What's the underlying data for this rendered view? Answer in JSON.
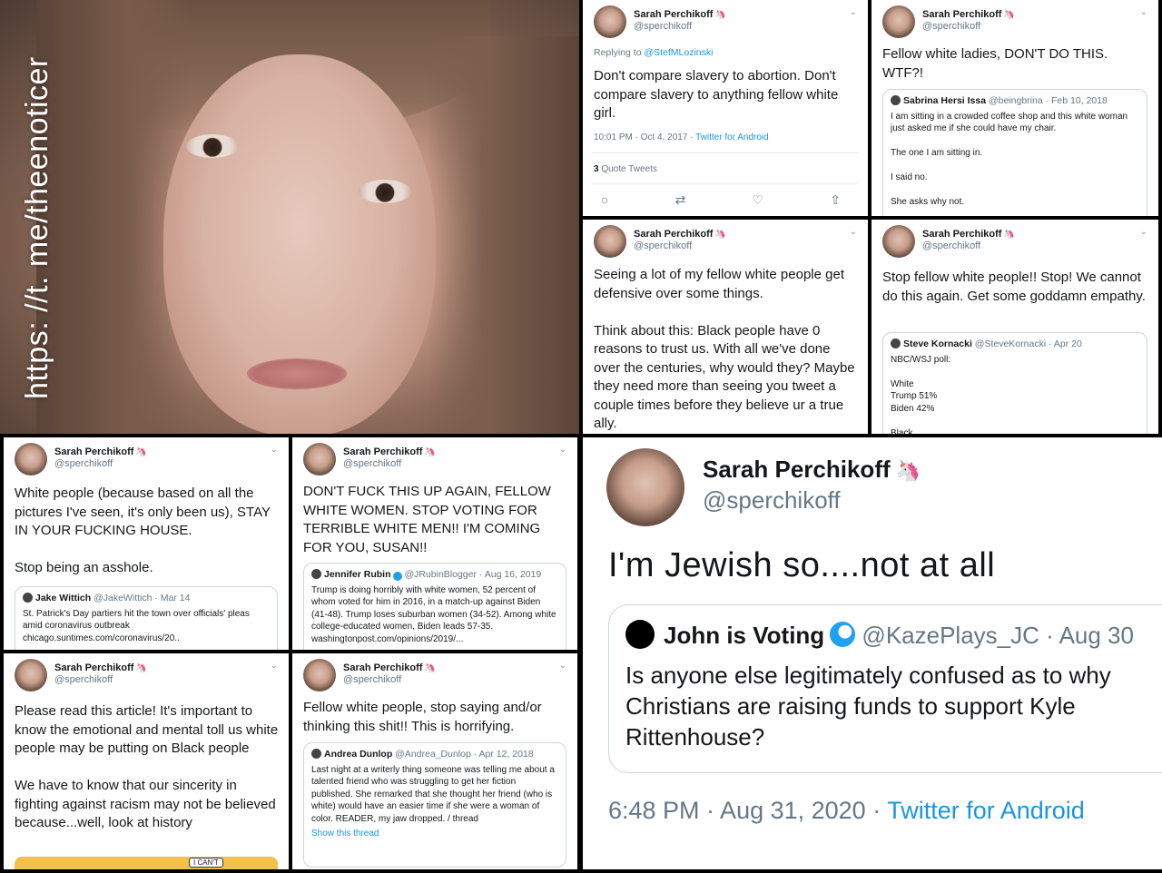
{
  "watermark": "https: //t. me/theenoticer",
  "author": {
    "name": "Sarah Perchikoff",
    "handle": "@sperchikoff",
    "emoji": "🦄"
  },
  "t1": {
    "reply": "Replying to",
    "reply_to": "@StefMLozinski",
    "text": "Don't compare slavery to abortion. Don't compare slavery to anything fellow white girl.",
    "time": "10:01 PM · Oct 4, 2017 ·",
    "source": "Twitter for Android",
    "quote_count": "3",
    "quote_label": "Quote Tweets"
  },
  "t2": {
    "text": "Fellow white ladies, DON'T DO THIS. WTF?!",
    "q_name": "Sabrina Hersi Issa",
    "q_meta": "@beingbrina · Feb 10, 2018",
    "q_text": "I am sitting in a crowded coffee shop and this white woman just asked me if she could have my chair.\n\nThe one I am sitting in.\n\nI said no.\n\nShe asks why not."
  },
  "t3": {
    "text": "Seeing a lot of my fellow white people get defensive over some things.\n\nThink about this: Black people have 0 reasons to trust us. With all we've done over the centuries, why would they? Maybe they need more than seeing you tweet a couple times before they believe ur a true ally."
  },
  "t4": {
    "text": "Stop fellow white people!! Stop! We cannot do this again. Get some goddamn empathy.",
    "q_name": "Steve Kornacki",
    "q_meta": "@SteveKornacki · Apr 20",
    "q_text": "NBC/WSJ poll:\n\nWhite\nTrump 51%\nBiden 42%\n\nBlack"
  },
  "t5": {
    "text": "White people (because based on all the pictures I've seen, it's only been us), STAY IN YOUR FUCKING HOUSE.\n\nStop being an asshole.",
    "q_name": "Jake Wittich",
    "q_meta": "@JakeWittich · Mar 14",
    "q_text": "St. Patrick's Day partiers hit the town over officials' pleas amid coronavirus outbreak\nchicago.suntimes.com/coronavirus/20.."
  },
  "t6": {
    "text": "DON'T FUCK THIS UP AGAIN, FELLOW WHITE WOMEN. STOP VOTING FOR TERRIBLE WHITE MEN!! I'M COMING FOR YOU, SUSAN!!",
    "q_name": "Jennifer Rubin",
    "q_meta": "@JRubinBlogger · Aug 16, 2019",
    "q_text": "Trump is doing horribly with white women, 52 percent of whom voted for him in 2016, in a match-up against Biden (41-48). Trump loses suburban women (34-52). Among white college-educated women, Biden leads 57-35.  washingtonpost.com/opinions/2019/..."
  },
  "t7": {
    "text": "Please read this article! It's important to know the emotional and mental toll us white people may be putting on Black people\n\nWe have to know that our sincerity in fighting against racism may not be believed because...well, look at history",
    "img_text": "I CAN'T"
  },
  "t8": {
    "text": "Fellow white people, stop saying and/or thinking this shit!! This is horrifying.",
    "q_name": "Andrea Dunlop",
    "q_meta": "@Andrea_Dunlop · Apr 12, 2018",
    "q_text": "Last night at a writerly thing someone was telling me about a talented friend who was struggling to get her fiction published. She remarked that she thought her friend (who is white) would have an easier time if she were a woman of color. READER, my jaw dropped. / thread",
    "q_link": "Show this thread"
  },
  "big": {
    "text": "I'm Jewish so....not at all",
    "q_name": "John is Voting",
    "q_meta": "@KazePlays_JC · Aug 30",
    "q_text": "Is anyone else legitimately confused as to why Christians are raising funds to support Kyle Rittenhouse?",
    "time": "6:48 PM · Aug 31, 2020 ·",
    "source": "Twitter for Android"
  }
}
